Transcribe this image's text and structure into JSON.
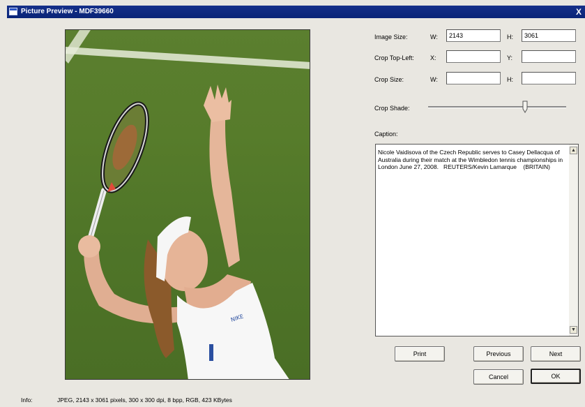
{
  "window": {
    "title": "Picture Preview - MDF39660",
    "close_glyph": "X"
  },
  "image_size": {
    "label": "Image Size:",
    "w_label": "W:",
    "w_value": "2143",
    "h_label": "H:",
    "h_value": "3061"
  },
  "crop_top_left": {
    "label": "Crop Top-Left:",
    "x_label": "X:",
    "x_value": "",
    "y_label": "Y:",
    "y_value": ""
  },
  "crop_size": {
    "label": "Crop Size:",
    "w_label": "W:",
    "w_value": "",
    "h_label": "H:",
    "h_value": ""
  },
  "crop_shade": {
    "label": "Crop Shade:",
    "level": 0.7
  },
  "caption": {
    "label": "Caption:",
    "text": "Nicole Vaidisova of the Czech Republic serves to Casey Dellacqua of Australia during their match at the Wimbledon tennis championships in London June 27, 2008.   REUTERS/Kevin Lamarque    (BRITAIN)"
  },
  "buttons": {
    "print": "Print",
    "previous": "Previous",
    "next": "Next",
    "cancel": "Cancel",
    "ok": "OK"
  },
  "info": {
    "label": "Info:",
    "text": "JPEG, 2143 x 3061 pixels, 300 x 300 dpi, 8 bpp, RGB, 423 KBytes"
  },
  "photo": {
    "shirt_logo_text": "NIKE"
  },
  "colors": {
    "titlebar": "#0a2478",
    "grass": "#577c2b"
  }
}
